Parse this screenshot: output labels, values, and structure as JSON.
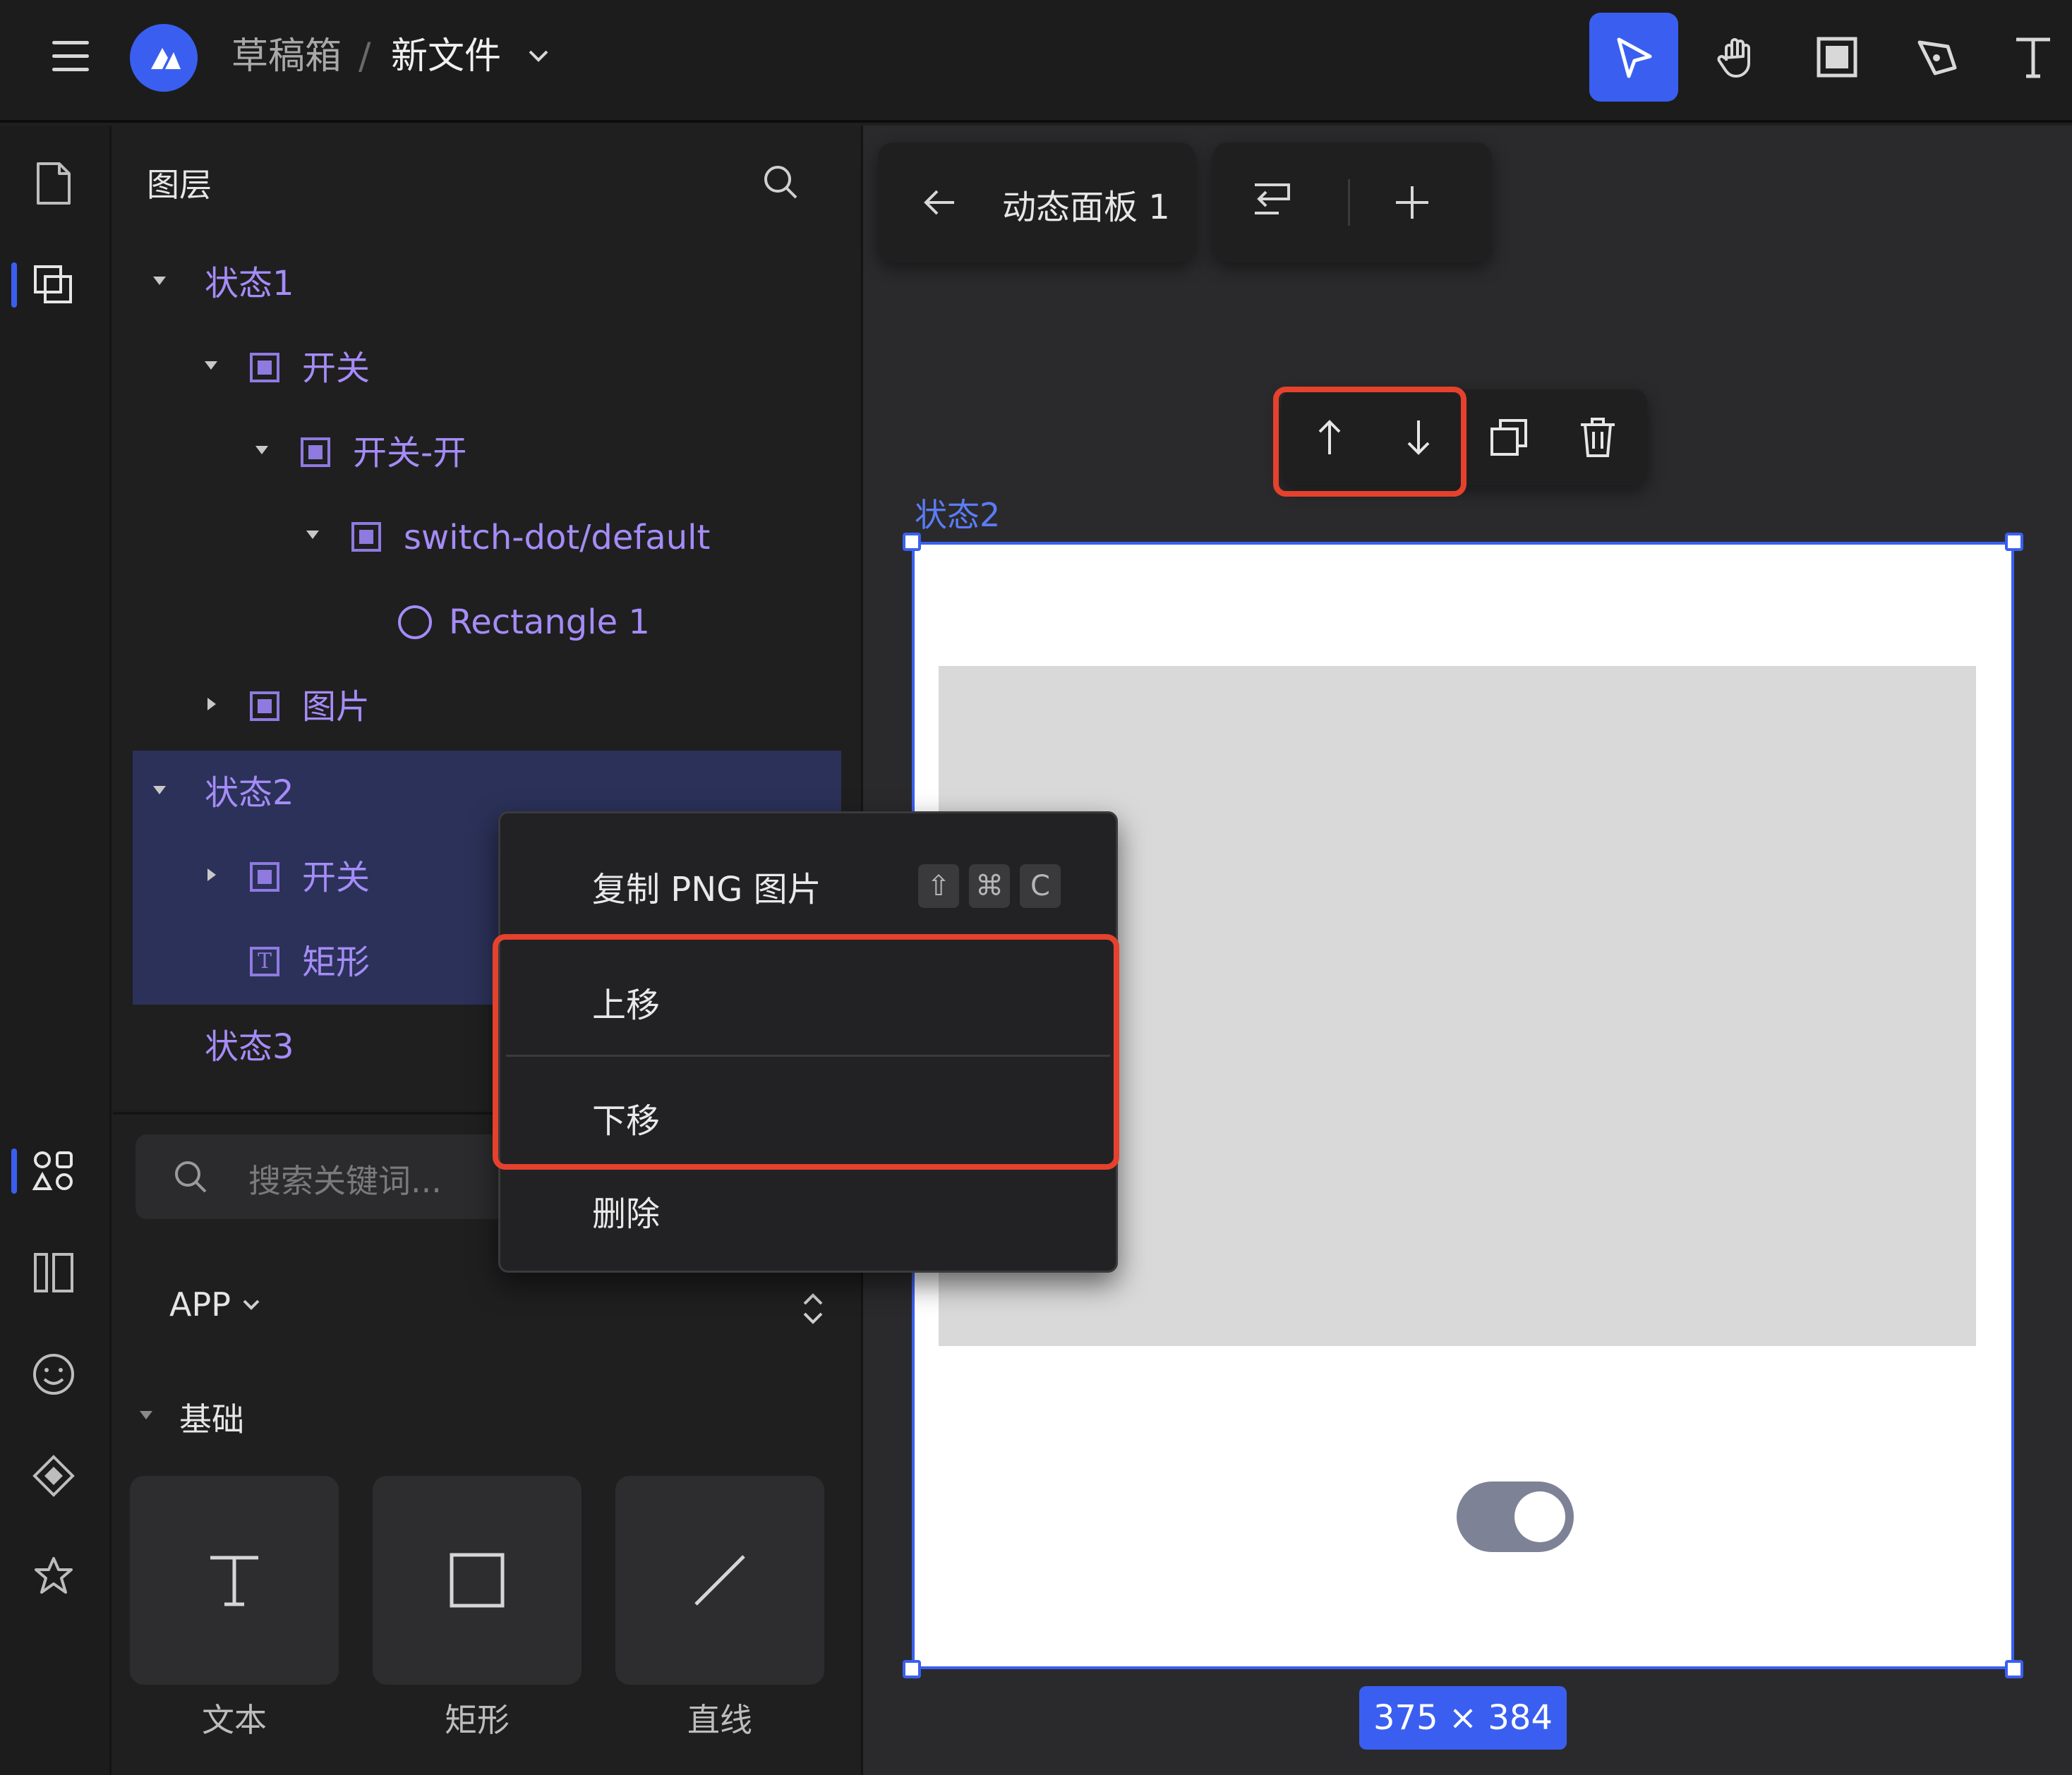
{
  "breadcrumb": {
    "folder": "草稿箱",
    "separator": "/",
    "file": "新文件"
  },
  "layers_panel": {
    "title": "图层",
    "rows": [
      {
        "label": "状态1"
      },
      {
        "label": "开关"
      },
      {
        "label": "开关-开"
      },
      {
        "label": "switch-dot/default"
      },
      {
        "label": "Rectangle 1"
      },
      {
        "label": "图片"
      },
      {
        "label": "状态2"
      },
      {
        "label": "开关"
      },
      {
        "label": "矩形"
      },
      {
        "label": "状态3"
      }
    ]
  },
  "components_panel": {
    "search_placeholder": "搜索关键词...",
    "library": "APP",
    "section": "基础",
    "tiles": [
      {
        "label": "文本"
      },
      {
        "label": "矩形"
      },
      {
        "label": "直线"
      }
    ]
  },
  "canvas": {
    "panel_title": "动态面板 1",
    "state_label": "状态2",
    "size_badge": "375 × 384"
  },
  "context_menu": {
    "items": [
      {
        "label": "复制 PNG 图片",
        "shortcut": [
          "⇧",
          "⌘",
          "C"
        ]
      },
      {
        "label": "上移"
      },
      {
        "label": "下移"
      },
      {
        "label": "删除"
      }
    ]
  },
  "colors": {
    "accent": "#3a5ff0",
    "highlight": "#e5412d",
    "layer_text": "#a58cf7",
    "selection": "#2b3158"
  }
}
